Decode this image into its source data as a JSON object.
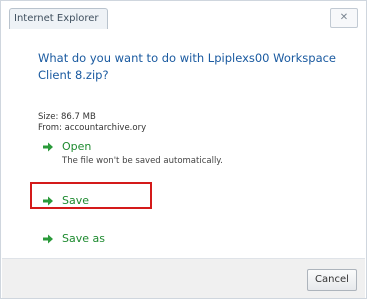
{
  "window": {
    "title": "Internet Explorer",
    "close_glyph": "✕"
  },
  "dialog": {
    "question": "What do you want to do with Lpiplexs00 Workspace Client 8.zip?",
    "size_text": "Size: 86.7 MB",
    "from_text": "From: accountarchive.ory"
  },
  "options": [
    {
      "icon": "green-arrow-icon",
      "label": "Open",
      "description": "The file won't be saved automatically."
    },
    {
      "icon": "green-arrow-icon",
      "label": "Save",
      "description": ""
    },
    {
      "icon": "green-arrow-icon",
      "label": "Save as",
      "description": ""
    }
  ],
  "footer": {
    "cancel_label": "Cancel"
  },
  "colors": {
    "link_blue": "#1a5aa0",
    "option_green": "#1d8a2f",
    "highlight_red": "#d41a1a"
  }
}
